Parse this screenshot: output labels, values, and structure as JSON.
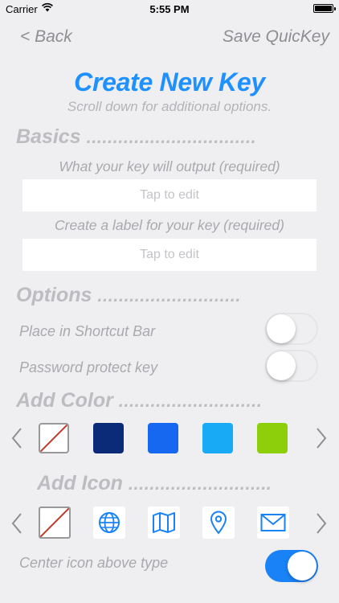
{
  "status_bar": {
    "carrier": "Carrier",
    "time": "5:55 PM",
    "battery_level": 1.0
  },
  "nav": {
    "back_label": "< Back",
    "save_label": "Save QuicKey"
  },
  "header": {
    "title": "Create New Key",
    "subtitle": "Scroll down for additional options."
  },
  "basics": {
    "heading": "Basics",
    "output_hint": "What your key will output (required)",
    "output_placeholder": "Tap to edit",
    "label_hint": "Create a label for your key (required)",
    "label_placeholder": "Tap to edit"
  },
  "options": {
    "heading": "Options",
    "shortcut_bar_label": "Place in Shortcut Bar",
    "shortcut_bar_on": false,
    "password_label": "Password protect key",
    "password_on": false
  },
  "color": {
    "heading": "Add Color",
    "swatches": [
      "none",
      "#0b2a78",
      "#1768f0",
      "#19aaf5",
      "#8dcf0a"
    ]
  },
  "icon": {
    "heading": "Add Icon",
    "icons": [
      "none-icon",
      "globe-icon",
      "map-icon",
      "location-pin-icon",
      "envelope-icon"
    ],
    "center_label": "Center icon above type",
    "center_on": true
  },
  "colors": {
    "accent": "#1a82f7",
    "title": "#1e90ff"
  }
}
